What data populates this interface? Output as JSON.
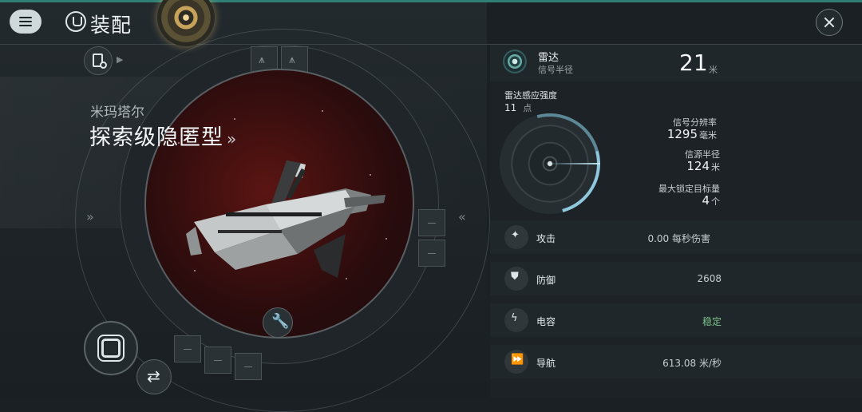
{
  "header": {
    "title": "装配"
  },
  "ship": {
    "owner": "米玛塔尔",
    "name": "探索级隐匿型",
    "name_chevron": "»"
  },
  "viewer": {
    "left_arrows": "»",
    "right_arrows": "«"
  },
  "radar": {
    "label": "雷达",
    "sublabel": "信号半径",
    "value": "21",
    "unit": "米",
    "sensor_strength_label": "雷达感应强度",
    "sensor_strength_value": "11",
    "sensor_strength_unit": "点",
    "stats": [
      {
        "label": "信号分辨率",
        "value": "1295",
        "unit": "毫米"
      },
      {
        "label": "信源半径",
        "value": "124",
        "unit": "米"
      },
      {
        "label": "最大锁定目标量",
        "value": "4",
        "unit": "个"
      }
    ]
  },
  "rows": [
    {
      "label": "攻击",
      "value": "0.00 每秒伤害",
      "icon": "turret-icon"
    },
    {
      "label": "防御",
      "value": "2608",
      "icon": "shield-icon"
    },
    {
      "label": "电容",
      "value": "稳定",
      "icon": "capacitor-icon",
      "color": "#7cc38a"
    },
    {
      "label": "导航",
      "value": "613.08 米/秒",
      "icon": "navigation-icon"
    }
  ]
}
